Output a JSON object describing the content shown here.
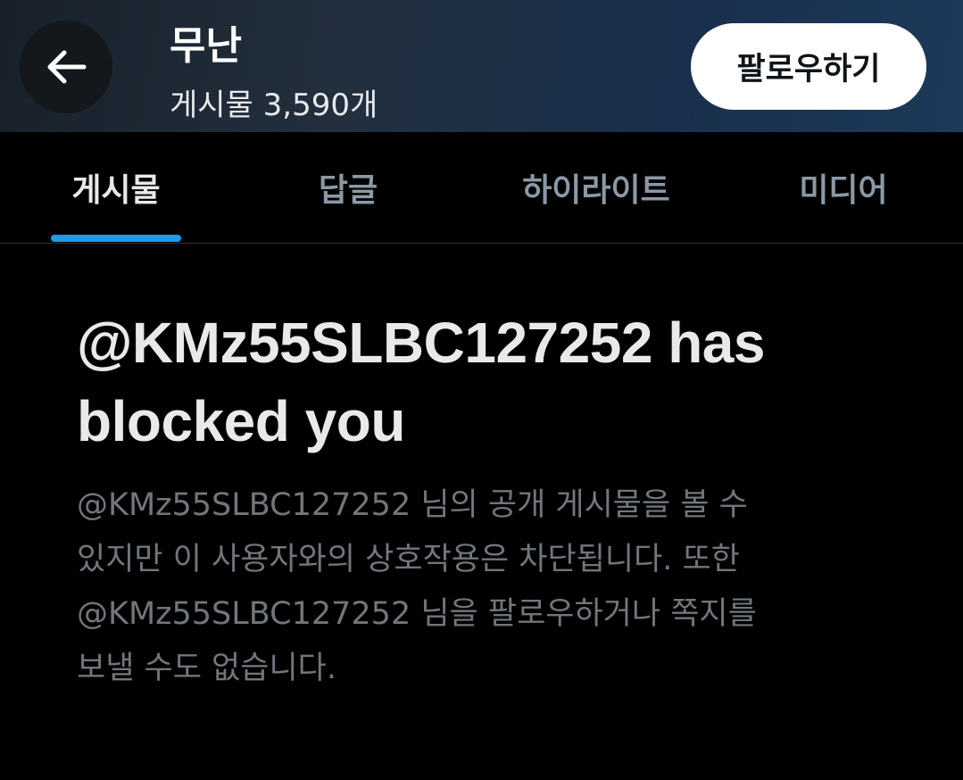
{
  "header": {
    "back_icon": "arrow-left-icon",
    "name": "무난",
    "post_count": "게시물 3,590개",
    "follow_label": "팔로우하기"
  },
  "tabs": [
    {
      "label": "게시물",
      "active": true
    },
    {
      "label": "답글",
      "active": false
    },
    {
      "label": "하이라이트",
      "active": false
    },
    {
      "label": "미디어",
      "active": false
    }
  ],
  "blocked": {
    "title_line1": "@KMz55SLBC127252 has",
    "title_line2": "blocked you",
    "desc_lines": [
      "@KMz55SLBC127252 님의 공개 게시물을 볼 수",
      "있지만 이 사용자와의 상호작용은 차단됩니다. 또한",
      "@KMz55SLBC127252 님을 팔로우하거나 쪽지를",
      "보낼 수도 없습니다."
    ]
  },
  "colors": {
    "background": "#000000",
    "accent": "#1d9bf0",
    "text_primary": "#e7e9ea",
    "text_secondary": "#71767b",
    "tab_inactive": "#8b98a5"
  }
}
